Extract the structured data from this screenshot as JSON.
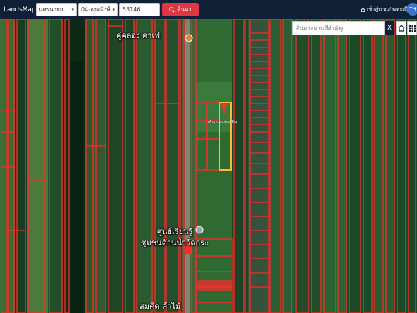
{
  "navbar": {
    "logo_text": "LandsMaps",
    "province": "นครนายก",
    "district": "04-องครักษ์",
    "parcel_no": "53146",
    "search_label": "ค้นหา",
    "login_label": "เข้าสู่ระบบ/ลงทะเบียน",
    "lang": "TH"
  },
  "map": {
    "place_search_placeholder": "ค้นหาสถานที่สำคัญ",
    "clear_label": "X",
    "labels": {
      "cafe": "คู่คลอง คาเฟ่",
      "center_line1": "ศูนย์เรียนรู้",
      "center_line2": "ชุมชนด้านน้ำวัดกระ",
      "store": "สมคิด ค้าไม้",
      "parcel_tag": "ตำแหน่งแปลงที่ดิน"
    }
  },
  "colors": {
    "navbar_bg": "#102036",
    "search_button": "#e0363f",
    "parcel_line": "#ff2a2a",
    "highlight_parcel": "#f2c12e",
    "marker": "#e0363f",
    "lang_badge": "#3b74c9"
  }
}
